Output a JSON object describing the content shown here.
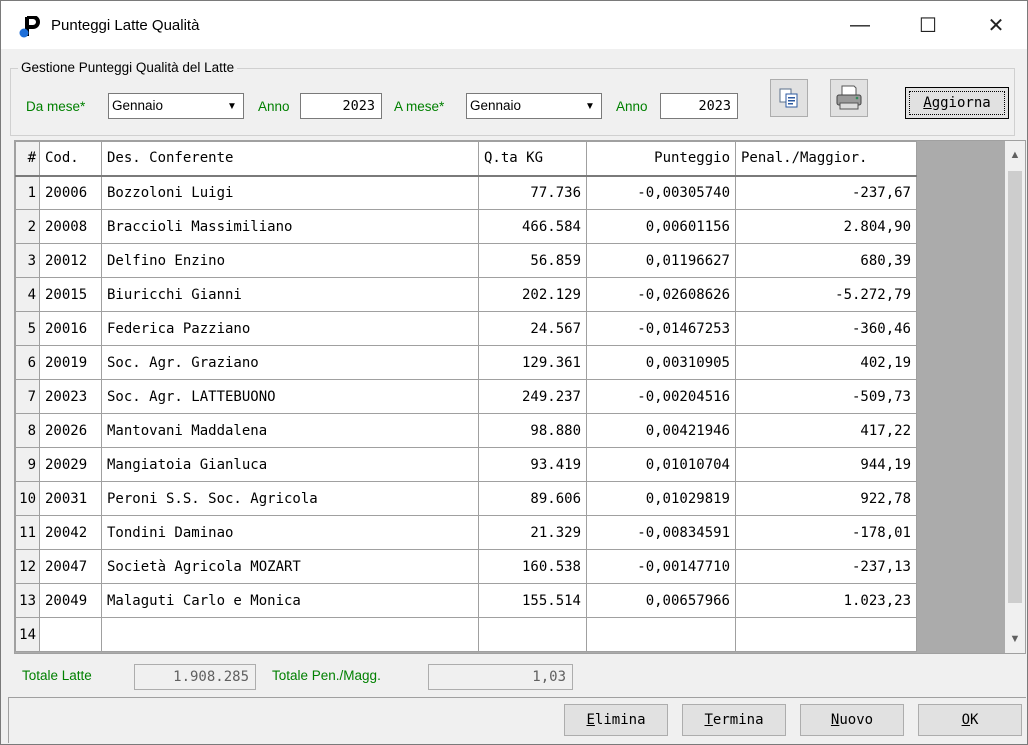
{
  "window": {
    "title": "Punteggi Latte Qualità",
    "minimize_glyph": "—",
    "maximize_glyph": "☐",
    "close_glyph": "✕"
  },
  "filters": {
    "group_title": "Gestione Punteggi Qualità del Latte",
    "from_month_label": "Da mese*",
    "from_month_value": "Gennaio",
    "from_year_label": "Anno",
    "from_year_value": "2023",
    "to_month_label": "A mese*",
    "to_month_value": "Gennaio",
    "to_year_label": "Anno",
    "to_year_value": "2023",
    "refresh_first": "A",
    "refresh_rest": "ggiorna"
  },
  "icons": {
    "copy": "copy-icon",
    "print": "printer-icon",
    "app": "app-logo-icon"
  },
  "table": {
    "columns": [
      "#",
      "Cod.",
      "Des. Conferente",
      "Q.ta KG",
      "Punteggio",
      "Penal./Maggior."
    ],
    "rows": [
      [
        "1",
        "20006",
        "Bozzoloni Luigi",
        "77.736",
        "-0,00305740",
        "-237,67"
      ],
      [
        "2",
        "20008",
        "Braccioli Massimiliano",
        "466.584",
        "0,00601156",
        "2.804,90"
      ],
      [
        "3",
        "20012",
        "Delfino Enzino",
        "56.859",
        "0,01196627",
        "680,39"
      ],
      [
        "4",
        "20015",
        "Biuricchi Gianni",
        "202.129",
        "-0,02608626",
        "-5.272,79"
      ],
      [
        "5",
        "20016",
        "Federica Pazziano",
        "24.567",
        "-0,01467253",
        "-360,46"
      ],
      [
        "6",
        "20019",
        "Soc. Agr. Graziano",
        "129.361",
        "0,00310905",
        "402,19"
      ],
      [
        "7",
        "20023",
        "Soc. Agr. LATTEBUONO",
        "249.237",
        "-0,00204516",
        "-509,73"
      ],
      [
        "8",
        "20026",
        "Mantovani Maddalena",
        "98.880",
        "0,00421946",
        "417,22"
      ],
      [
        "9",
        "20029",
        "Mangiatoia Gianluca",
        "93.419",
        "0,01010704",
        "944,19"
      ],
      [
        "10",
        "20031",
        "Peroni S.S. Soc. Agricola",
        "89.606",
        "0,01029819",
        "922,78"
      ],
      [
        "11",
        "20042",
        "Tondini Daminao",
        "21.329",
        "-0,00834591",
        "-178,01"
      ],
      [
        "12",
        "20047",
        "Società Agricola MOZART",
        "160.538",
        "-0,00147710",
        "-237,13"
      ],
      [
        "13",
        "20049",
        "Malaguti Carlo e Monica",
        "155.514",
        "0,00657966",
        "1.023,23"
      ],
      [
        "14",
        "",
        "",
        "",
        "",
        ""
      ]
    ]
  },
  "totals": {
    "milk_label": "Totale Latte",
    "milk_value": "1.908.285",
    "pen_label": "Totale Pen./Magg.",
    "pen_value": "1,03"
  },
  "buttons": {
    "delete_first": "E",
    "delete_rest": "limina",
    "close_first": "T",
    "close_rest": "ermina",
    "new_first": "N",
    "new_rest": "uovo",
    "ok_first": "O",
    "ok_rest": "K"
  }
}
